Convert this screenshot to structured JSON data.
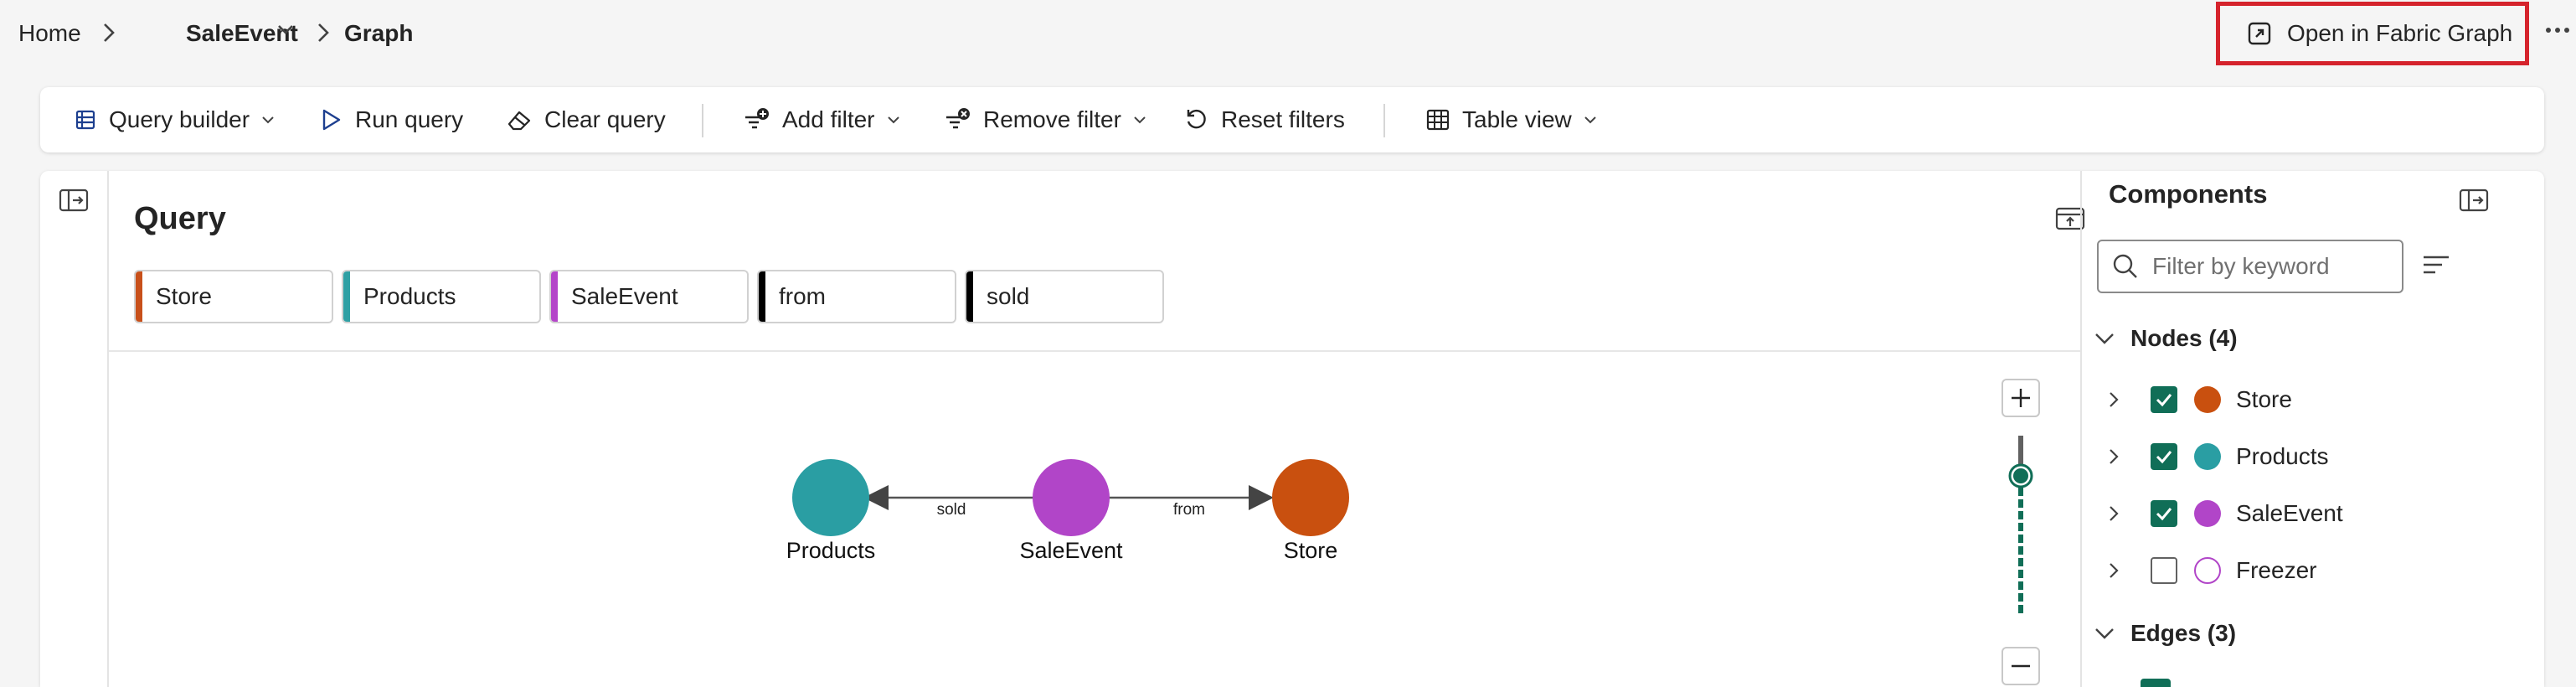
{
  "breadcrumb": {
    "home": "Home",
    "event": "SaleEvent",
    "current": "Graph"
  },
  "header": {
    "open_fabric_label": "Open in Fabric Graph"
  },
  "toolbar": {
    "query_builder": "Query builder",
    "run_query": "Run query",
    "clear_query": "Clear query",
    "add_filter": "Add filter",
    "remove_filter": "Remove filter",
    "reset_filters": "Reset filters",
    "table_view": "Table view"
  },
  "query": {
    "title": "Query",
    "chips": [
      {
        "label": "Store",
        "color": "#c8501a"
      },
      {
        "label": "Products",
        "color": "#2fa0a4"
      },
      {
        "label": "SaleEvent",
        "color": "#b445c9"
      },
      {
        "label": "from",
        "color": "#000000"
      },
      {
        "label": "sold",
        "color": "#000000"
      }
    ]
  },
  "graph": {
    "nodes": [
      {
        "label": "Products",
        "color": "#2a9ea3"
      },
      {
        "label": "SaleEvent",
        "color": "#b145c8"
      },
      {
        "label": "Store",
        "color": "#c9500f"
      }
    ],
    "edges": [
      {
        "label": "sold",
        "from": "SaleEvent",
        "to": "Products"
      },
      {
        "label": "from",
        "from": "SaleEvent",
        "to": "Store"
      }
    ]
  },
  "components": {
    "title": "Components",
    "filter_placeholder": "Filter by keyword",
    "nodes_header": "Nodes (4)",
    "nodes": [
      {
        "label": "Store",
        "checked": true,
        "color": "#c9500f"
      },
      {
        "label": "Products",
        "checked": true,
        "color": "#2a9ea3"
      },
      {
        "label": "SaleEvent",
        "checked": true,
        "color": "#b145c8"
      },
      {
        "label": "Freezer",
        "checked": false,
        "color": "#b145c8"
      }
    ],
    "edges_header": "Edges (3)"
  },
  "colors": {
    "accent": "#106e57",
    "highlight_border": "#d5232c"
  }
}
